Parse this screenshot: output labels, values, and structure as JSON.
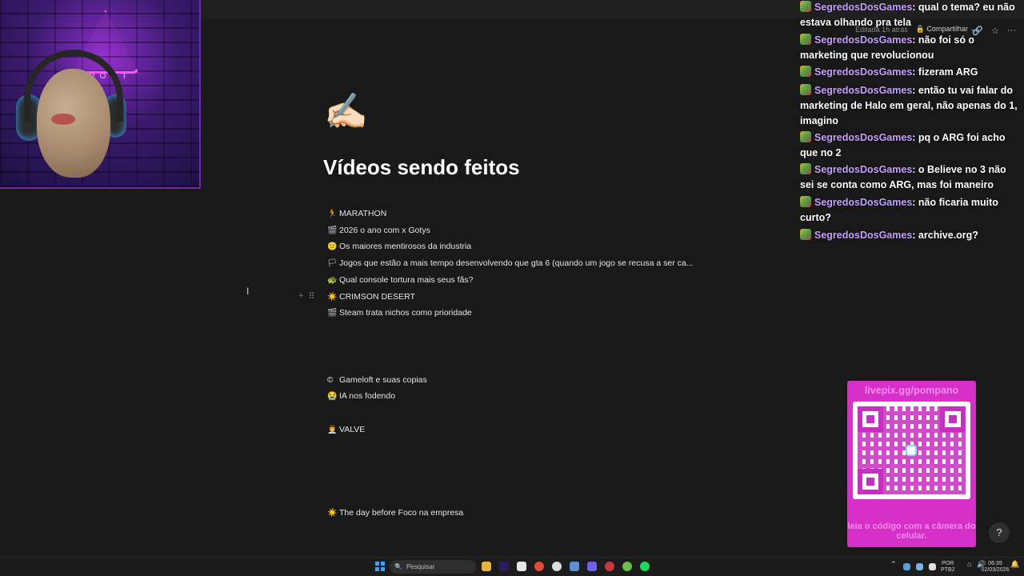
{
  "doc": {
    "edited": "Editada 1h atrás",
    "share_label": "Compartilhar",
    "page_icon": "✍🏻",
    "title": "Vídeos sendo feitos"
  },
  "items": [
    {
      "emoji": "🏃",
      "label": "MARATHON"
    },
    {
      "emoji": "🎬",
      "label": "2026 o ano com x Gotys"
    },
    {
      "emoji": "😕",
      "label": "Os maiores mentirosos da industria"
    },
    {
      "emoji": "🏳",
      "label": "Jogos que estão a mais tempo desenvolvendo que gta 6 (quando um jogo se recusa a ser ca..."
    },
    {
      "emoji": "🐢",
      "label": "Qual console tortura mais seus fãs?"
    },
    {
      "emoji": "☀️",
      "label": "CRIMSON DESERT"
    },
    {
      "emoji": "🎬",
      "label": "Steam trata nichos como prioridade"
    },
    {
      "emoji": "©",
      "label": "Gameloft e suas copias"
    },
    {
      "emoji": "😭",
      "label": "IA nos fodendo"
    },
    {
      "emoji": "👨‍💼",
      "label": "VALVE"
    },
    {
      "emoji": "☀️",
      "label": "The day before Foco na empresa"
    }
  ],
  "chat": [
    {
      "user": "SegredosDosGames",
      "text": "qual o tema? eu não estava olhando pra tela"
    },
    {
      "user": "SegredosDosGames",
      "text": "não foi só o marketing que revolucionou"
    },
    {
      "user": "SegredosDosGames",
      "text": "fizeram ARG"
    },
    {
      "user": "SegredosDosGames",
      "text": "então tu vai falar do marketing de Halo em geral, não apenas do 1, imagino"
    },
    {
      "user": "SegredosDosGames",
      "text": "pq o ARG foi acho que no 2"
    },
    {
      "user": "SegredosDosGames",
      "text": "o Believe no 3 não sei se conta como ARG, mas foi maneiro"
    },
    {
      "user": "SegredosDosGames",
      "text": "não ficaria muito curto?"
    },
    {
      "user": "SegredosDosGames",
      "text": "archive.org?"
    }
  ],
  "livepix": {
    "title": "livepix.gg/pompano",
    "caption": "leia o código com a câmera do celular."
  },
  "taskbar": {
    "search_placeholder": "Pesquisar",
    "lang_top": "POR",
    "lang_bottom": "PTB2",
    "time": "06:39",
    "date": "02/03/2026"
  },
  "webcam": {
    "sign_text": "POOT"
  },
  "help_label": "?",
  "colors": {
    "background": "#191919",
    "chat_user": "#c8a0ff",
    "livepix": "#d630c8"
  }
}
